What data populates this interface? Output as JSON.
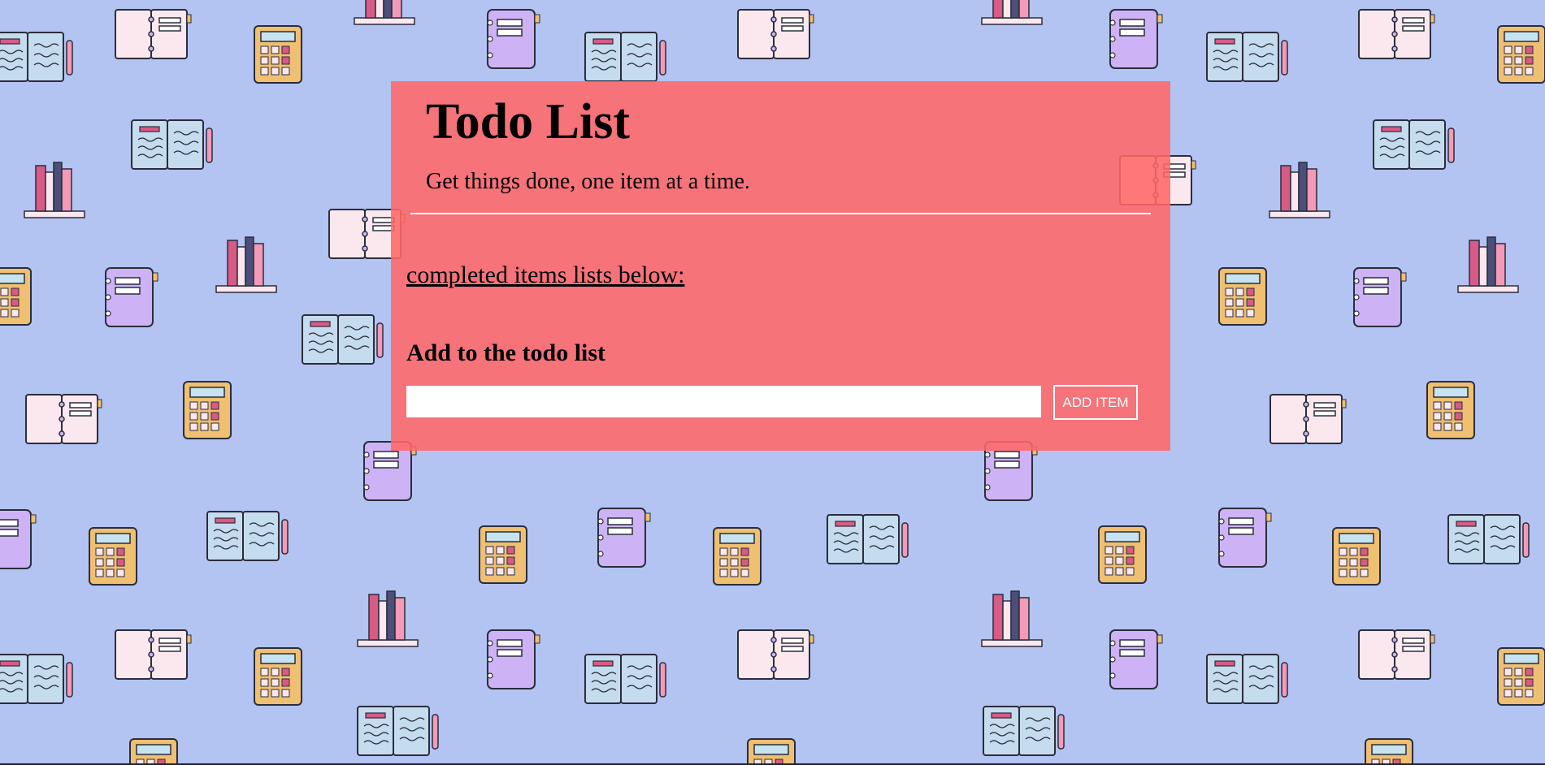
{
  "colors": {
    "page_background": "#b3c4f3",
    "card_background": "#ff6868",
    "button_text": "#ffffff",
    "pattern_notebook_open": "#fbe8ee",
    "pattern_notebook_blue": "#c5dbee",
    "pattern_notebook_purple": "#cdb3f5",
    "pattern_calculator": "#efbf72",
    "pattern_accent": "#d85a86"
  },
  "header": {
    "title": "Todo List",
    "subtitle": "Get things done, one item at a time."
  },
  "completed": {
    "link_label": "completed items lists below:"
  },
  "add_form": {
    "heading": "Add to the todo list",
    "input_value": "",
    "button_label": "ADD ITEM"
  },
  "background": {
    "pattern_icons": [
      "open-notebook-icon",
      "spiral-notebook-icon",
      "calculator-icon",
      "book-stack-icon",
      "closed-notebook-icon"
    ]
  }
}
